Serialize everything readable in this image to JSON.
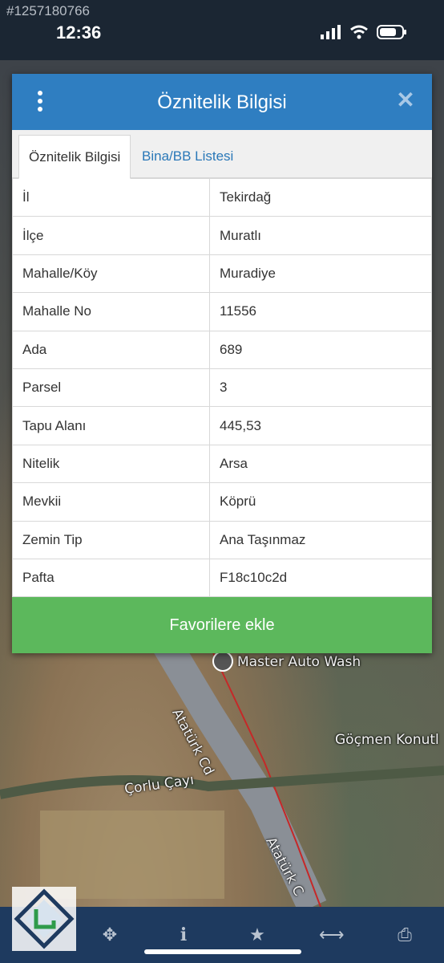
{
  "status_bar": {
    "watermark_id": "#1257180766",
    "time": "12:36"
  },
  "dialog": {
    "title": "Öznitelik Bilgisi",
    "tabs": [
      {
        "label": "Öznitelik Bilgisi",
        "active": true
      },
      {
        "label": "Bina/BB Listesi",
        "active": false
      }
    ],
    "rows": [
      {
        "key": "İl",
        "value": "Tekirdağ"
      },
      {
        "key": "İlçe",
        "value": "Muratlı"
      },
      {
        "key": "Mahalle/Köy",
        "value": "Muradiye"
      },
      {
        "key": "Mahalle No",
        "value": "11556"
      },
      {
        "key": "Ada",
        "value": "689"
      },
      {
        "key": "Parsel",
        "value": "3"
      },
      {
        "key": "Tapu Alanı",
        "value": "445,53"
      },
      {
        "key": "Nitelik",
        "value": "Arsa"
      },
      {
        "key": "Mevkii",
        "value": "Köprü"
      },
      {
        "key": "Zemin Tip",
        "value": "Ana Taşınmaz"
      },
      {
        "key": "Pafta",
        "value": "F18c10c2d"
      }
    ],
    "favorite_button": "Favorilere ekle"
  },
  "map": {
    "labels": {
      "master_auto_wash": "Master Auto Wash",
      "ataturk_cd_1": "Atatürk Cd",
      "ataturk_cd_2": "Atatürk C",
      "corlu_cayi": "Çorlu Çayı",
      "gocmen_konut": "Göçmen Konutl"
    }
  },
  "toolbar": {
    "icons": [
      "crosshair-icon",
      "info-icon",
      "star-icon",
      "measure-icon",
      "print-icon"
    ]
  },
  "colors": {
    "header_blue": "#2f7ec1",
    "favorite_green": "#5cb85c",
    "tab_link_blue": "#2a78b8",
    "toolbar_navy": "#1e3a5f"
  }
}
